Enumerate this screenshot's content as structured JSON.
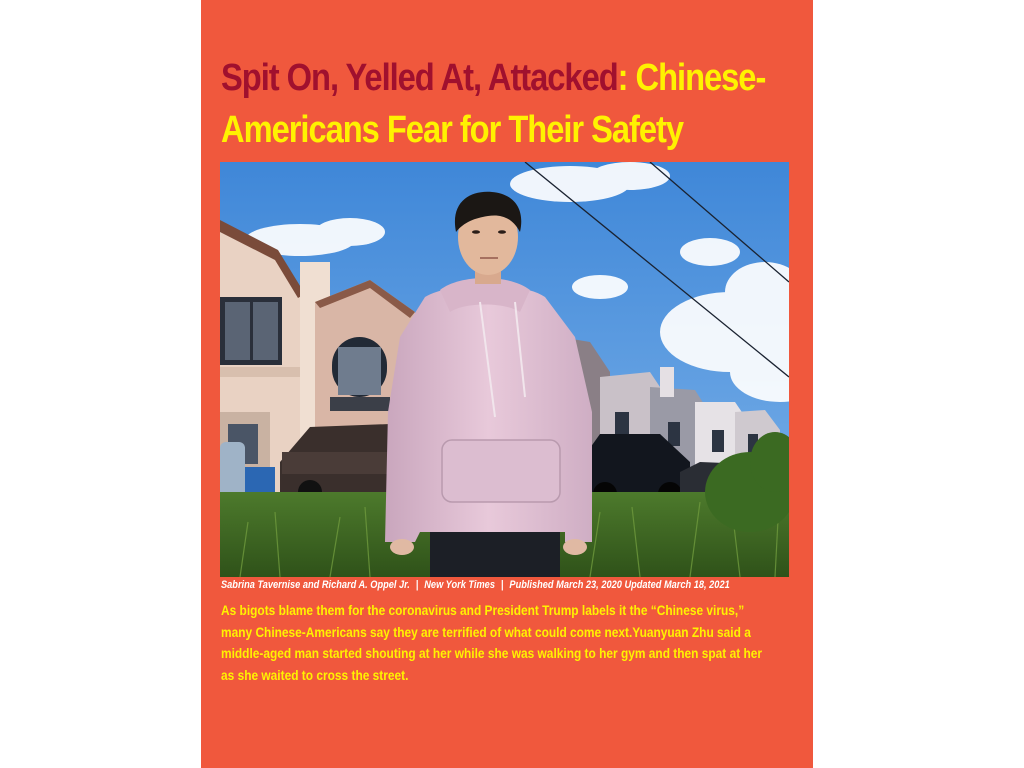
{
  "headline": {
    "part1": "Spit On, Yelled At, Attacked",
    "part2": ": Chinese-Americans Fear for Their Safety"
  },
  "byline": {
    "authors": "Sabrina Tavernise and Richard A. Oppel Jr.",
    "publication": "New York Times",
    "dates": "Published March 23, 2020 Updated March 18, 2021"
  },
  "summary": "As bigots blame them for the coronavirus and President Trump labels it the “Chinese virus,” many Chinese-Americans say they are terrified of what could come next.Yuanyuan Zhu said a middle-aged man started shouting at her while she was walking to her gym and then spat at her as she waited to cross the street.",
  "colors": {
    "page_background": "#f0583d",
    "headline_dark": "#a0102e",
    "headline_yellow": "#fff200",
    "summary_text": "#fff200",
    "byline_text": "#ffffff"
  }
}
